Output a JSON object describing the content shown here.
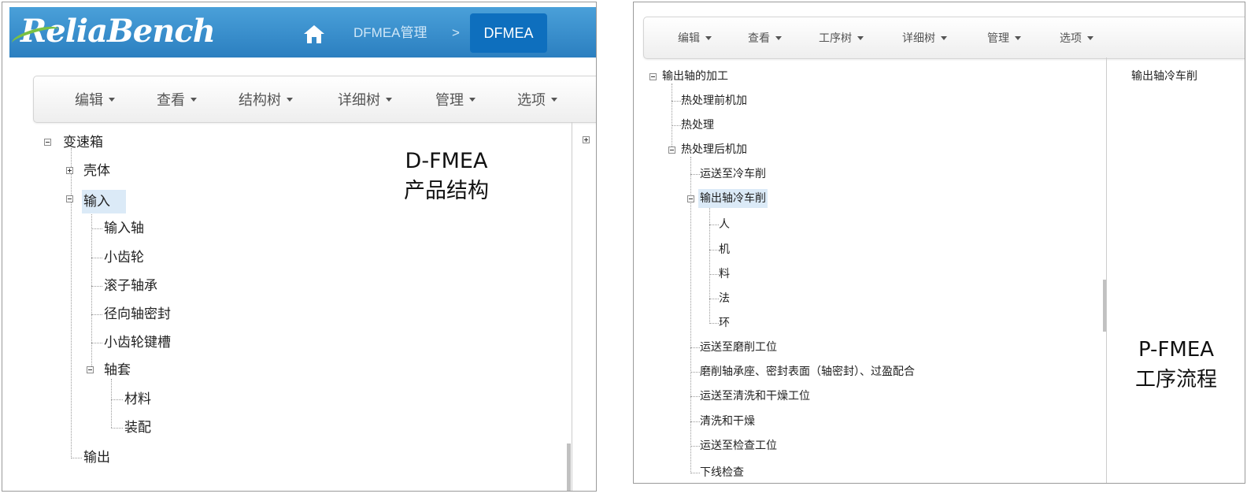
{
  "left": {
    "logo": "ReliaBench",
    "breadcrumb": {
      "parent": "DFMEA管理",
      "separator": ">",
      "current": "DFMEA"
    },
    "toolbar": [
      "编辑",
      "查看",
      "结构树",
      "详细树",
      "管理",
      "选项"
    ],
    "tree": {
      "root": "变速箱",
      "n1": "壳体",
      "n2": "输入",
      "n2_1": "输入轴",
      "n2_2": "小齿轮",
      "n2_3": "滚子轴承",
      "n2_4": "径向轴密封",
      "n2_5": "小齿轮键槽",
      "n2_6": "轴套",
      "n2_6_1": "材料",
      "n2_6_2": "装配",
      "n3": "输出"
    },
    "annotation": {
      "line1": "D-FMEA",
      "line2": "产品结构"
    }
  },
  "right": {
    "toolbar": [
      "编辑",
      "查看",
      "工序树",
      "详细树",
      "管理",
      "选项"
    ],
    "side_label": "输出轴冷车削",
    "tree": {
      "root": "输出轴的加工",
      "n1": "热处理前机加",
      "n2": "热处理",
      "n3": "热处理后机加",
      "n3_1": "运送至冷车削",
      "n3_2": "输出轴冷车削",
      "n3_2_1": "人",
      "n3_2_2": "机",
      "n3_2_3": "料",
      "n3_2_4": "法",
      "n3_2_5": "环",
      "n3_3": "运送至磨削工位",
      "n3_4": "磨削轴承座、密封表面（轴密封）、过盈配合",
      "n3_5": "运送至清洗和干燥工位",
      "n3_6": "清洗和干燥",
      "n3_7": "运送至检查工位",
      "n3_8": "下线检查"
    },
    "annotation": {
      "line1": "P-FMEA",
      "line2": "工序流程"
    }
  },
  "colors": {
    "header_blue": "#2b7fc0",
    "crumb_active": "#0e6fbe",
    "selection": "#dbeaf7",
    "logo_swoosh": "#7ac143"
  }
}
